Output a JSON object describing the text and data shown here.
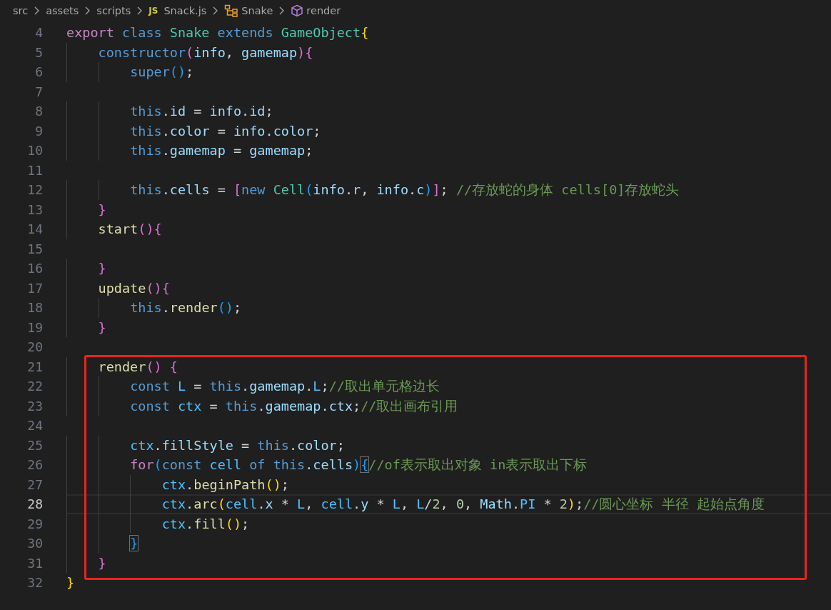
{
  "breadcrumb": [
    {
      "kind": "folder",
      "label": "src"
    },
    {
      "kind": "folder",
      "label": "assets"
    },
    {
      "kind": "folder",
      "label": "scripts"
    },
    {
      "kind": "js",
      "badge": "JS",
      "label": "Snack.js"
    },
    {
      "kind": "class",
      "label": "Snake"
    },
    {
      "kind": "method",
      "label": "render"
    }
  ],
  "blocks": [
    {
      "boxed": false,
      "lines": [
        {
          "number": "4",
          "selected": false,
          "tokens": [
            {
              "kind": "keyword",
              "t": "export"
            },
            {
              "kind": "storage",
              "t": " class"
            },
            {
              "kind": "type",
              "t": " Snake"
            },
            {
              "kind": "storage",
              "t": " extends"
            },
            {
              "kind": "type",
              "t": " GameObject"
            },
            {
              "kind": "bracket1",
              "t": "{"
            }
          ]
        },
        {
          "number": "5",
          "selected": false,
          "tokens": [
            {
              "kind": "storage",
              "t": "    constructor"
            },
            {
              "kind": "bracket2",
              "t": "("
            },
            {
              "kind": "variable",
              "t": "info"
            },
            {
              "kind": "plain",
              "t": ","
            },
            {
              "kind": "variable",
              "t": " gamemap"
            },
            {
              "kind": "bracket2",
              "t": "){"
            }
          ]
        },
        {
          "number": "6",
          "selected": false,
          "tokens": [
            {
              "kind": "storage",
              "t": "        super"
            },
            {
              "kind": "bracket3",
              "t": "()"
            },
            {
              "kind": "plain",
              "t": ";"
            }
          ]
        },
        {
          "number": "7",
          "selected": false
        },
        {
          "number": "8",
          "selected": false,
          "tokens": [
            {
              "kind": "storage",
              "t": "        this"
            },
            {
              "kind": "plain",
              "t": "."
            },
            {
              "kind": "variable",
              "t": "id"
            },
            {
              "kind": "plain",
              "t": " = "
            },
            {
              "kind": "variable",
              "t": "info"
            },
            {
              "kind": "plain",
              "t": "."
            },
            {
              "kind": "variable",
              "t": "id"
            },
            {
              "kind": "plain",
              "t": ";"
            }
          ]
        },
        {
          "number": "9",
          "selected": false,
          "tokens": [
            {
              "kind": "storage",
              "t": "        this"
            },
            {
              "kind": "plain",
              "t": "."
            },
            {
              "kind": "variable",
              "t": "color"
            },
            {
              "kind": "plain",
              "t": " = "
            },
            {
              "kind": "variable",
              "t": "info"
            },
            {
              "kind": "plain",
              "t": "."
            },
            {
              "kind": "variable",
              "t": "color"
            },
            {
              "kind": "plain",
              "t": ";"
            }
          ]
        },
        {
          "number": "10",
          "selected": false,
          "tokens": [
            {
              "kind": "storage",
              "t": "        this"
            },
            {
              "kind": "plain",
              "t": "."
            },
            {
              "kind": "variable",
              "t": "gamemap"
            },
            {
              "kind": "plain",
              "t": " = "
            },
            {
              "kind": "variable",
              "t": "gamemap"
            },
            {
              "kind": "plain",
              "t": ";"
            }
          ]
        },
        {
          "number": "11",
          "selected": false
        },
        {
          "number": "12",
          "selected": false,
          "tokens": [
            {
              "kind": "storage",
              "t": "        this"
            },
            {
              "kind": "plain",
              "t": "."
            },
            {
              "kind": "variable",
              "t": "cells"
            },
            {
              "kind": "plain",
              "t": " = "
            },
            {
              "kind": "bracket2",
              "t": "["
            },
            {
              "kind": "storage",
              "t": "new"
            },
            {
              "kind": "type",
              "t": " Cell"
            },
            {
              "kind": "bracket3",
              "t": "("
            },
            {
              "kind": "variable",
              "t": "info"
            },
            {
              "kind": "plain",
              "t": "."
            },
            {
              "kind": "variable",
              "t": "r"
            },
            {
              "kind": "plain",
              "t": ","
            },
            {
              "kind": "variable",
              "t": " info"
            },
            {
              "kind": "plain",
              "t": "."
            },
            {
              "kind": "variable",
              "t": "c"
            },
            {
              "kind": "bracket3",
              "t": ")"
            },
            {
              "kind": "bracket2",
              "t": "]"
            },
            {
              "kind": "plain",
              "t": ";"
            },
            {
              "kind": "comment",
              "t": " //存放蛇的身体 cells[0]存放蛇头"
            }
          ]
        },
        {
          "number": "13",
          "selected": false,
          "tokens": [
            {
              "kind": "bracket2",
              "t": "    }"
            }
          ]
        },
        {
          "number": "14",
          "selected": false,
          "tokens": [
            {
              "kind": "function",
              "t": "    start"
            },
            {
              "kind": "bracket2",
              "t": "(){"
            }
          ]
        },
        {
          "number": "15",
          "selected": false
        },
        {
          "number": "16",
          "selected": false,
          "tokens": [
            {
              "kind": "bracket2",
              "t": "    }"
            }
          ]
        },
        {
          "number": "17",
          "selected": false,
          "tokens": [
            {
              "kind": "function",
              "t": "    update"
            },
            {
              "kind": "bracket2",
              "t": "(){"
            }
          ]
        },
        {
          "number": "18",
          "selected": false,
          "tokens": [
            {
              "kind": "storage",
              "t": "        this"
            },
            {
              "kind": "plain",
              "t": "."
            },
            {
              "kind": "function",
              "t": "render"
            },
            {
              "kind": "bracket3",
              "t": "()"
            },
            {
              "kind": "plain",
              "t": ";"
            }
          ]
        },
        {
          "number": "19",
          "selected": false,
          "tokens": [
            {
              "kind": "bracket2",
              "t": "    }"
            }
          ]
        },
        {
          "number": "20",
          "selected": false
        }
      ]
    },
    {
      "boxed": true,
      "lines": [
        {
          "number": "21",
          "selected": false,
          "tokens": [
            {
              "kind": "function",
              "t": "    render"
            },
            {
              "kind": "bracket2",
              "t": "()"
            },
            {
              "kind": "bracket2",
              "t": " {"
            }
          ]
        },
        {
          "number": "22",
          "selected": false,
          "tokens": [
            {
              "kind": "storage",
              "t": "        const"
            },
            {
              "kind": "constant",
              "t": " L"
            },
            {
              "kind": "plain",
              "t": " = "
            },
            {
              "kind": "storage",
              "t": "this"
            },
            {
              "kind": "plain",
              "t": "."
            },
            {
              "kind": "variable",
              "t": "gamemap"
            },
            {
              "kind": "plain",
              "t": "."
            },
            {
              "kind": "constant",
              "t": "L"
            },
            {
              "kind": "plain",
              "t": ";"
            },
            {
              "kind": "comment",
              "t": "//取出单元格边长"
            }
          ]
        },
        {
          "number": "23",
          "selected": false,
          "tokens": [
            {
              "kind": "storage",
              "t": "        const"
            },
            {
              "kind": "constant",
              "t": " ctx"
            },
            {
              "kind": "plain",
              "t": " = "
            },
            {
              "kind": "storage",
              "t": "this"
            },
            {
              "kind": "plain",
              "t": "."
            },
            {
              "kind": "variable",
              "t": "gamemap"
            },
            {
              "kind": "plain",
              "t": "."
            },
            {
              "kind": "variable",
              "t": "ctx"
            },
            {
              "kind": "plain",
              "t": ";"
            },
            {
              "kind": "comment",
              "t": "//取出画布引用"
            }
          ]
        },
        {
          "number": "24",
          "selected": false
        },
        {
          "number": "25",
          "selected": false,
          "tokens": [
            {
              "kind": "constant",
              "t": "        ctx"
            },
            {
              "kind": "plain",
              "t": "."
            },
            {
              "kind": "variable",
              "t": "fillStyle"
            },
            {
              "kind": "plain",
              "t": " = "
            },
            {
              "kind": "storage",
              "t": "this"
            },
            {
              "kind": "plain",
              "t": "."
            },
            {
              "kind": "variable",
              "t": "color"
            },
            {
              "kind": "plain",
              "t": ";"
            }
          ]
        },
        {
          "number": "26",
          "selected": false,
          "tokens": [
            {
              "kind": "keyword",
              "t": "        for"
            },
            {
              "kind": "bracket3",
              "t": "("
            },
            {
              "kind": "storage",
              "t": "const"
            },
            {
              "kind": "constant",
              "t": " cell"
            },
            {
              "kind": "storage",
              "t": " of"
            },
            {
              "kind": "storage",
              "t": " this"
            },
            {
              "kind": "plain",
              "t": "."
            },
            {
              "kind": "variable",
              "t": "cells"
            },
            {
              "kind": "bracket3",
              "t": ")"
            },
            {
              "kind": "matched",
              "t": "{"
            },
            {
              "kind": "comment",
              "t": "//of表示取出对象 in表示取出下标"
            }
          ]
        },
        {
          "number": "27",
          "selected": false,
          "tokens": [
            {
              "kind": "constant",
              "t": "            ctx"
            },
            {
              "kind": "plain",
              "t": "."
            },
            {
              "kind": "function",
              "t": "beginPath"
            },
            {
              "kind": "bracket1",
              "t": "()"
            },
            {
              "kind": "plain",
              "t": ";"
            }
          ]
        },
        {
          "number": "28",
          "selected": true,
          "tokens": [
            {
              "kind": "constant",
              "t": "            ctx"
            },
            {
              "kind": "plain",
              "t": "."
            },
            {
              "kind": "function",
              "t": "arc"
            },
            {
              "kind": "bracket1",
              "t": "("
            },
            {
              "kind": "constant",
              "t": "cell"
            },
            {
              "kind": "plain",
              "t": "."
            },
            {
              "kind": "variable",
              "t": "x"
            },
            {
              "kind": "plain",
              "t": " * "
            },
            {
              "kind": "constant",
              "t": "L"
            },
            {
              "kind": "plain",
              "t": ","
            },
            {
              "kind": "constant",
              "t": " cell"
            },
            {
              "kind": "plain",
              "t": "."
            },
            {
              "kind": "variable",
              "t": "y"
            },
            {
              "kind": "plain",
              "t": " * "
            },
            {
              "kind": "constant",
              "t": "L"
            },
            {
              "kind": "plain",
              "t": ","
            },
            {
              "kind": "constant",
              "t": " L"
            },
            {
              "kind": "plain",
              "t": "/"
            },
            {
              "kind": "number",
              "t": "2"
            },
            {
              "kind": "plain",
              "t": ","
            },
            {
              "kind": "number",
              "t": " 0"
            },
            {
              "kind": "plain",
              "t": ","
            },
            {
              "kind": "variable",
              "t": " Math"
            },
            {
              "kind": "plain",
              "t": "."
            },
            {
              "kind": "constant",
              "t": "PI"
            },
            {
              "kind": "plain",
              "t": " * "
            },
            {
              "kind": "number",
              "t": "2"
            },
            {
              "kind": "bracket1",
              "t": ")"
            },
            {
              "kind": "plain",
              "t": ";"
            },
            {
              "kind": "comment",
              "t": "//圆心坐标 半径 起始点角度"
            }
          ]
        },
        {
          "number": "29",
          "selected": false,
          "tokens": [
            {
              "kind": "constant",
              "t": "            ctx"
            },
            {
              "kind": "plain",
              "t": "."
            },
            {
              "kind": "function",
              "t": "fill"
            },
            {
              "kind": "bracket1",
              "t": "()"
            },
            {
              "kind": "plain",
              "t": ";"
            }
          ]
        },
        {
          "number": "30",
          "selected": false,
          "tokens": [
            {
              "kind": "matched",
              "t": "        }"
            }
          ]
        },
        {
          "number": "31",
          "selected": false,
          "tokens": [
            {
              "kind": "bracket2",
              "t": "    }"
            }
          ]
        }
      ]
    },
    {
      "boxed": false,
      "lines": [
        {
          "number": "32",
          "selected": false,
          "tokens": [
            {
              "kind": "bracket1",
              "t": "}"
            }
          ]
        }
      ]
    }
  ]
}
